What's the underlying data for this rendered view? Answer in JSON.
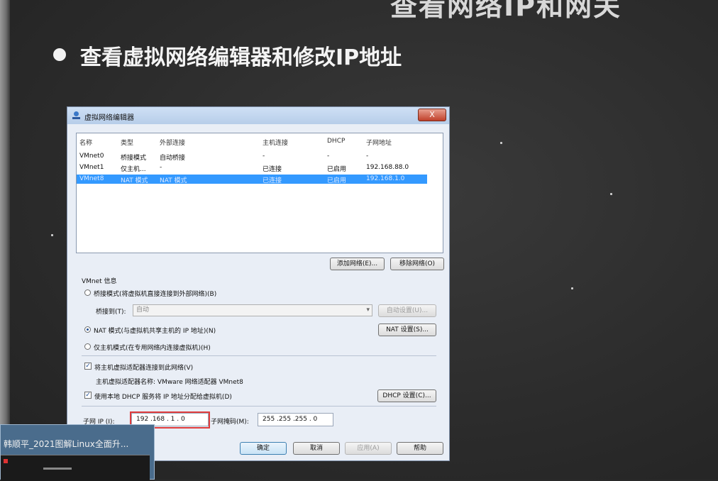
{
  "slide": {
    "top_title": "查看网络IP和网关",
    "bullet_text": "查看虚拟网络编辑器和修改IP地址"
  },
  "dialog": {
    "title": "虚拟网络编辑器",
    "close_glyph": "X",
    "columns": [
      "名称",
      "类型",
      "外部连接",
      "主机连接",
      "DHCP",
      "子网地址"
    ],
    "rows": [
      {
        "name": "VMnet0",
        "type": "桥接模式",
        "external": "自动桥接",
        "host": "-",
        "dhcp": "-",
        "subnet": "-"
      },
      {
        "name": "VMnet1",
        "type": "仅主机...",
        "external": "-",
        "host": "已连接",
        "dhcp": "已启用",
        "subnet": "192.168.88.0"
      },
      {
        "name": "VMnet8",
        "type": "NAT 模式",
        "external": "NAT 模式",
        "host": "已连接",
        "dhcp": "已启用",
        "subnet": "192.168.1.0",
        "selected": true
      }
    ],
    "add_network_button": "添加网络(E)...",
    "remove_network_button": "移除网络(O)",
    "vmnet_info_label": "VMnet 信息",
    "bridged_mode_label": "桥接模式(将虚拟机直接连接到外部网络)(B)",
    "bridged_to_label": "桥接到(T):",
    "bridged_to_value": "自动",
    "auto_settings_button": "自动设置(U)...",
    "nat_mode_label": "NAT 模式(与虚拟机共享主机的 IP 地址)(N)",
    "nat_settings_button": "NAT 设置(S)...",
    "host_only_label": "仅主机模式(在专用网络内连接虚拟机)(H)",
    "connect_adapter_label": "将主机虚拟适配器连接到此网络(V)",
    "adapter_name_label": "主机虚拟适配器名称: VMware 网络适配器 VMnet8",
    "use_dhcp_label": "使用本地 DHCP 服务将 IP 地址分配给虚拟机(D)",
    "dhcp_settings_button": "DHCP 设置(C)...",
    "subnet_ip_label": "子网 IP (I):",
    "subnet_ip_value": "192 .168 . 1 . 0",
    "subnet_mask_label": "子网掩码(M):",
    "subnet_mask_value": "255 .255 .255 . 0",
    "ok_button": "确定",
    "cancel_button": "取消",
    "apply_button": "应用(A)",
    "help_button": "帮助",
    "check_glyph": "✓"
  },
  "thumbnail": {
    "title": "韩顺平_2021图解Linux全面升..."
  },
  "colors": {
    "selection": "#3399ff",
    "highlight_frame": "#e03c3c"
  }
}
